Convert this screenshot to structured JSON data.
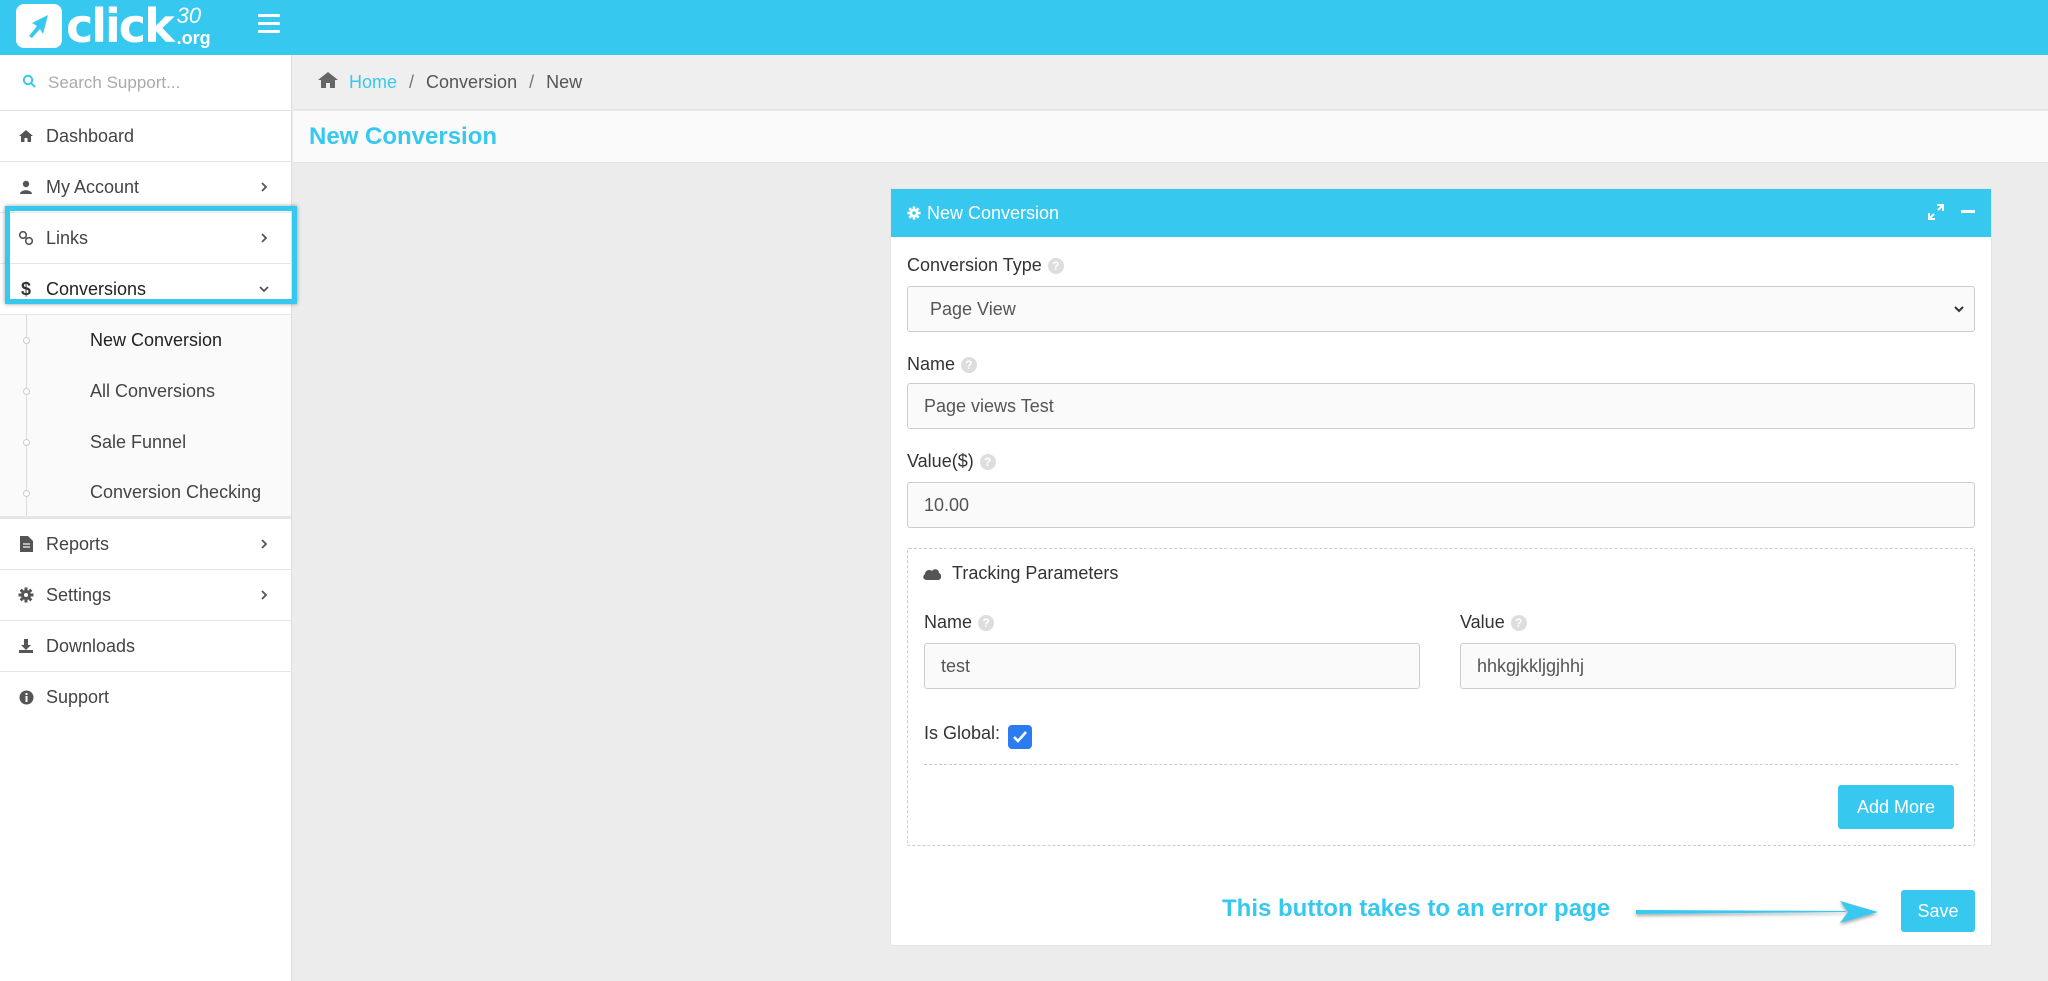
{
  "brand": {
    "word": "click",
    "sup_number": "30",
    "sup_domain": ".org"
  },
  "search": {
    "placeholder": "Search Support..."
  },
  "sidebar": {
    "items": [
      {
        "label": "Dashboard",
        "icon": "home-icon"
      },
      {
        "label": "My Account",
        "icon": "user-icon"
      },
      {
        "label": "Links",
        "icon": "link-icon"
      },
      {
        "label": "Conversions",
        "icon": "dollar-icon"
      },
      {
        "label": "Reports",
        "icon": "file-icon"
      },
      {
        "label": "Settings",
        "icon": "gear-icon"
      },
      {
        "label": "Downloads",
        "icon": "download-icon"
      },
      {
        "label": "Support",
        "icon": "info-icon"
      }
    ],
    "conversions_sub": [
      {
        "label": "New Conversion"
      },
      {
        "label": "All Conversions"
      },
      {
        "label": "Sale Funnel"
      },
      {
        "label": "Conversion Checking"
      }
    ]
  },
  "breadcrumb": {
    "home": "Home",
    "level1": "Conversion",
    "level2": "New",
    "separator": "/"
  },
  "page": {
    "title": "New Conversion"
  },
  "panel": {
    "title": "New Conversion",
    "conversion_type_label": "Conversion Type",
    "conversion_type_value": "Page View",
    "name_label": "Name",
    "name_value": "Page views Test",
    "value_label": "Value($)",
    "value_value": "10.00",
    "tracking": {
      "legend": "Tracking Parameters",
      "name_label": "Name",
      "name_value": "test",
      "value_label": "Value",
      "value_value": "hhkgjkkljgjhhj",
      "global_label": "Is Global:",
      "global_checked": true,
      "add_more_label": "Add More"
    },
    "save_label": "Save"
  },
  "annotation": {
    "text": "This button takes to an error page"
  },
  "colors": {
    "accent": "#37c8f0",
    "checkbox": "#2b7cf0"
  }
}
